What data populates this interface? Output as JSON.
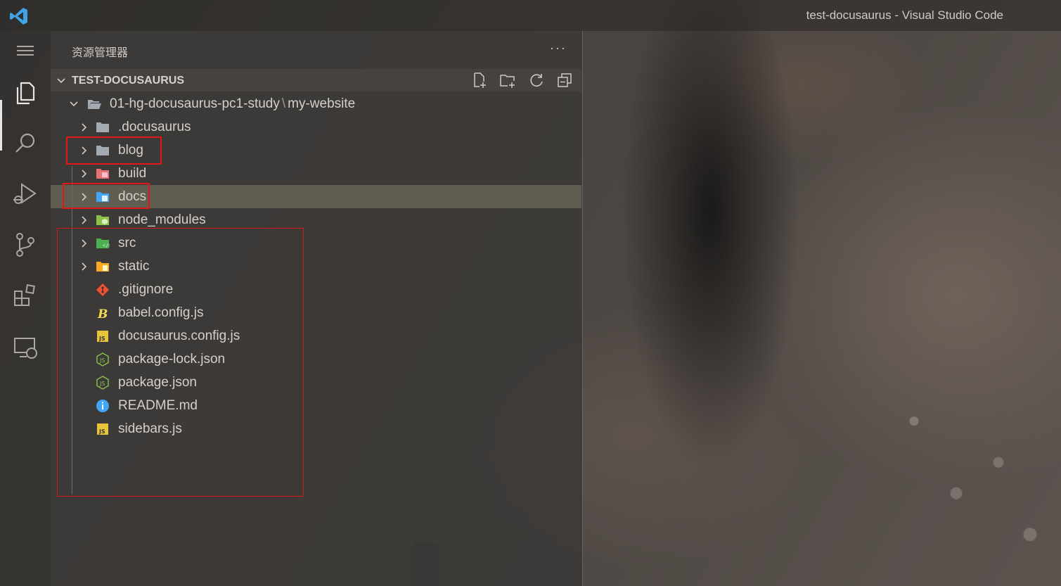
{
  "window": {
    "title": "test-docusaurus - Visual Studio Code"
  },
  "activity_bar": {
    "items": [
      {
        "icon": "menu-icon"
      },
      {
        "icon": "explorer-icon",
        "active": true
      },
      {
        "icon": "search-icon"
      },
      {
        "icon": "run-debug-icon"
      },
      {
        "icon": "source-control-icon"
      },
      {
        "icon": "extensions-icon"
      },
      {
        "icon": "remote-explorer-icon"
      }
    ]
  },
  "sidebar": {
    "title": "资源管理器",
    "more_label": "···",
    "section": {
      "title": "TEST-DOCUSAURUS",
      "actions": [
        "new-file-icon",
        "new-folder-icon",
        "refresh-icon",
        "collapse-all-icon"
      ]
    },
    "root": {
      "folder_path_left": "01-hg-docusaurus-pc1-study",
      "separator": "\\",
      "folder_path_right": "my-website"
    },
    "items": [
      {
        "label": ".docusaurus",
        "type": "folder",
        "icon": "folder-icon"
      },
      {
        "label": "blog",
        "type": "folder",
        "icon": "folder-icon"
      },
      {
        "label": "build",
        "type": "folder",
        "icon": "build-folder-icon"
      },
      {
        "label": "docs",
        "type": "folder",
        "icon": "docs-folder-icon",
        "selected": true
      },
      {
        "label": "node_modules",
        "type": "folder",
        "icon": "node-modules-folder-icon"
      },
      {
        "label": "src",
        "type": "folder",
        "icon": "src-folder-icon"
      },
      {
        "label": "static",
        "type": "folder",
        "icon": "static-folder-icon"
      },
      {
        "label": ".gitignore",
        "type": "file",
        "icon": "git-icon"
      },
      {
        "label": "babel.config.js",
        "type": "file",
        "icon": "babel-icon"
      },
      {
        "label": "docusaurus.config.js",
        "type": "file",
        "icon": "javascript-icon"
      },
      {
        "label": "package-lock.json",
        "type": "file",
        "icon": "nodejs-icon"
      },
      {
        "label": "package.json",
        "type": "file",
        "icon": "nodejs-icon"
      },
      {
        "label": "README.md",
        "type": "file",
        "icon": "info-icon"
      },
      {
        "label": "sidebars.js",
        "type": "file",
        "icon": "javascript-icon"
      }
    ]
  },
  "colors": {
    "annotation": "#e01818",
    "folder": "#9aa3ad",
    "js_badge": "#e8c43a",
    "node_green": "#8bc34a",
    "info_blue": "#42a5f5",
    "git_orange": "#f05133"
  }
}
